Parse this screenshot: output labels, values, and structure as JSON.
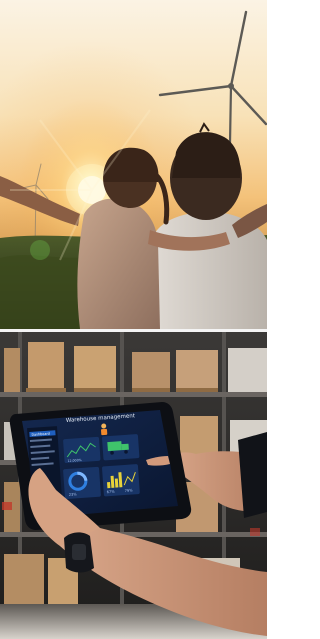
{
  "scene_top": {
    "alt": "Two children viewed from behind looking at wind turbines at sunset"
  },
  "scene_bottom": {
    "alt": "Hands holding a tablet showing a warehouse dashboard in front of warehouse shelves"
  },
  "tablet": {
    "title": "Warehouse management",
    "sidebar_items": [
      "Dashboard",
      "",
      "",
      "",
      "",
      ""
    ],
    "metrics": {
      "m1": "12,000%",
      "m2": "",
      "m3": "23%",
      "m4": "67%",
      "m5": "79%"
    }
  },
  "colors": {
    "sky_top": "#fdf0d8",
    "sky_horizon": "#f6c47a",
    "sun": "#fff7d6",
    "tablet_screen": "#0f1f3d",
    "accent_blue": "#2f7fe0",
    "accent_green": "#3fc36b",
    "accent_yellow": "#e7d23a"
  },
  "icons": [
    "wind-turbine-icon",
    "truck-icon",
    "worker-icon"
  ]
}
